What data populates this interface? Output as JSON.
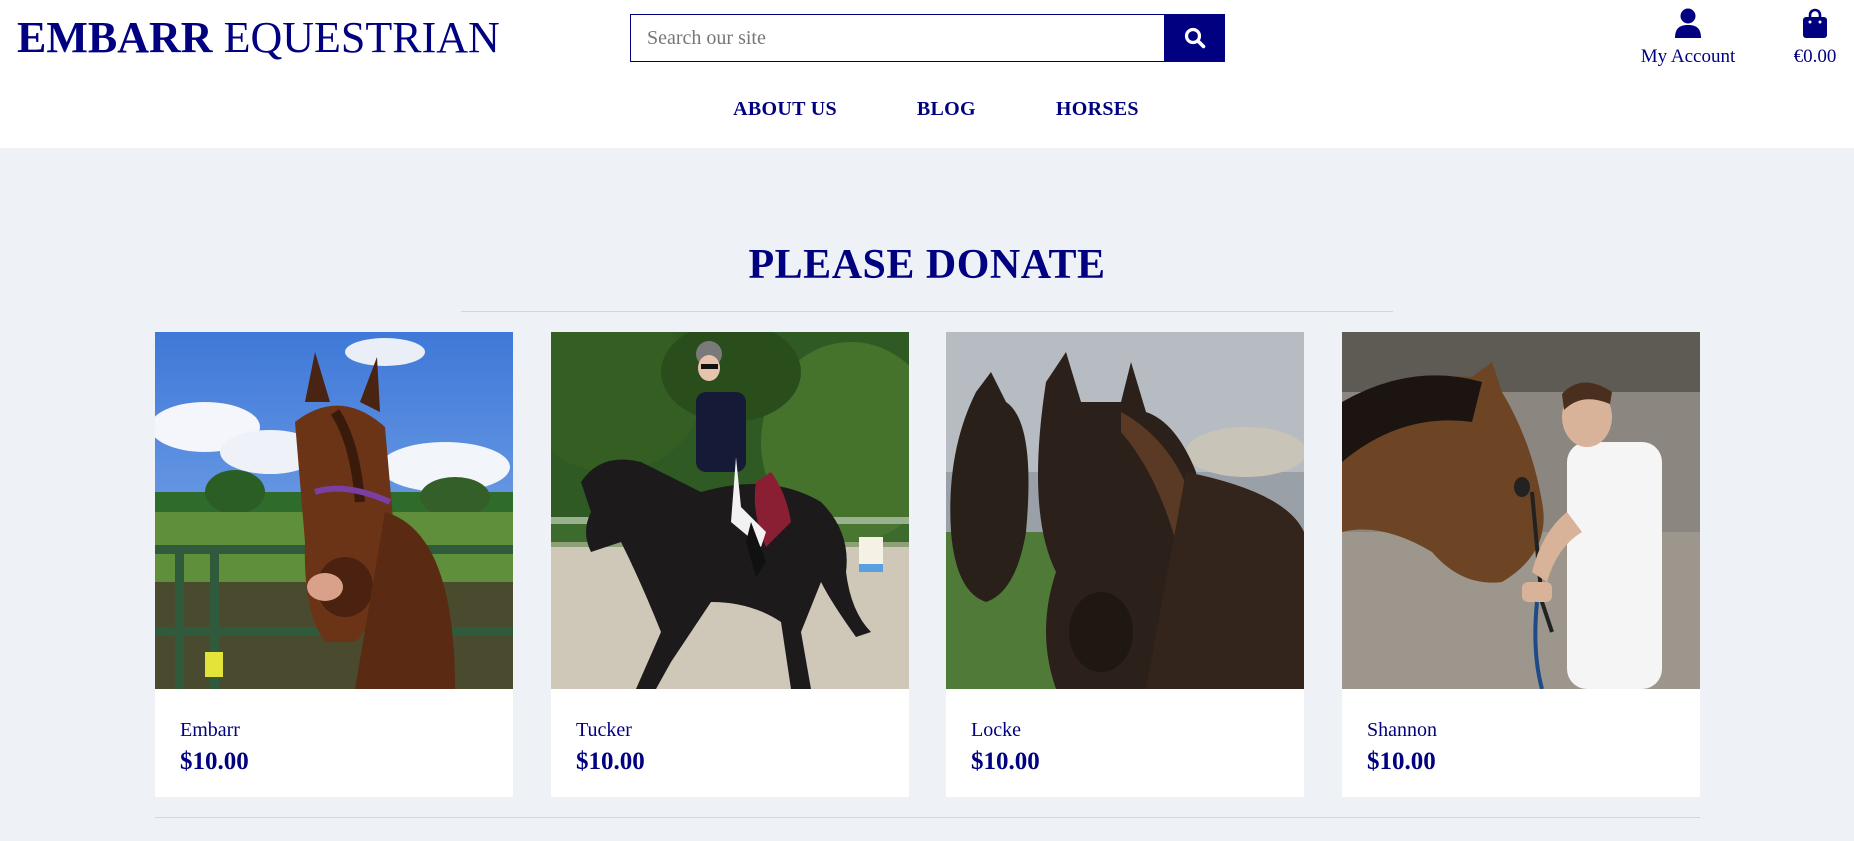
{
  "brand": {
    "bold": "EMBARR",
    "light": " EQUESTRIAN"
  },
  "search": {
    "placeholder": "Search our site",
    "value": "",
    "icon": "search-icon"
  },
  "account": {
    "label": "My Account",
    "icon": "user-icon"
  },
  "bag": {
    "total": "€0.00",
    "icon": "shopping-bag-icon"
  },
  "nav": [
    {
      "label": "ABOUT US"
    },
    {
      "label": "BLOG"
    },
    {
      "label": "HORSES"
    }
  ],
  "page": {
    "title": "PLEASE DONATE"
  },
  "products": [
    {
      "name": "Embarr",
      "price": "$10.00",
      "image": "bay horse behind a green fence under blue sky"
    },
    {
      "name": "Tucker",
      "price": "$10.00",
      "image": "rider on a black horse in an arena"
    },
    {
      "name": "Locke",
      "price": "$10.00",
      "image": "two dark horses close up in a field"
    },
    {
      "name": "Shannon",
      "price": "$10.00",
      "image": "bay horse with a man in a white shirt"
    }
  ],
  "colors": {
    "brand": "#000080",
    "background": "#eef1f6",
    "surface": "#ffffff"
  }
}
